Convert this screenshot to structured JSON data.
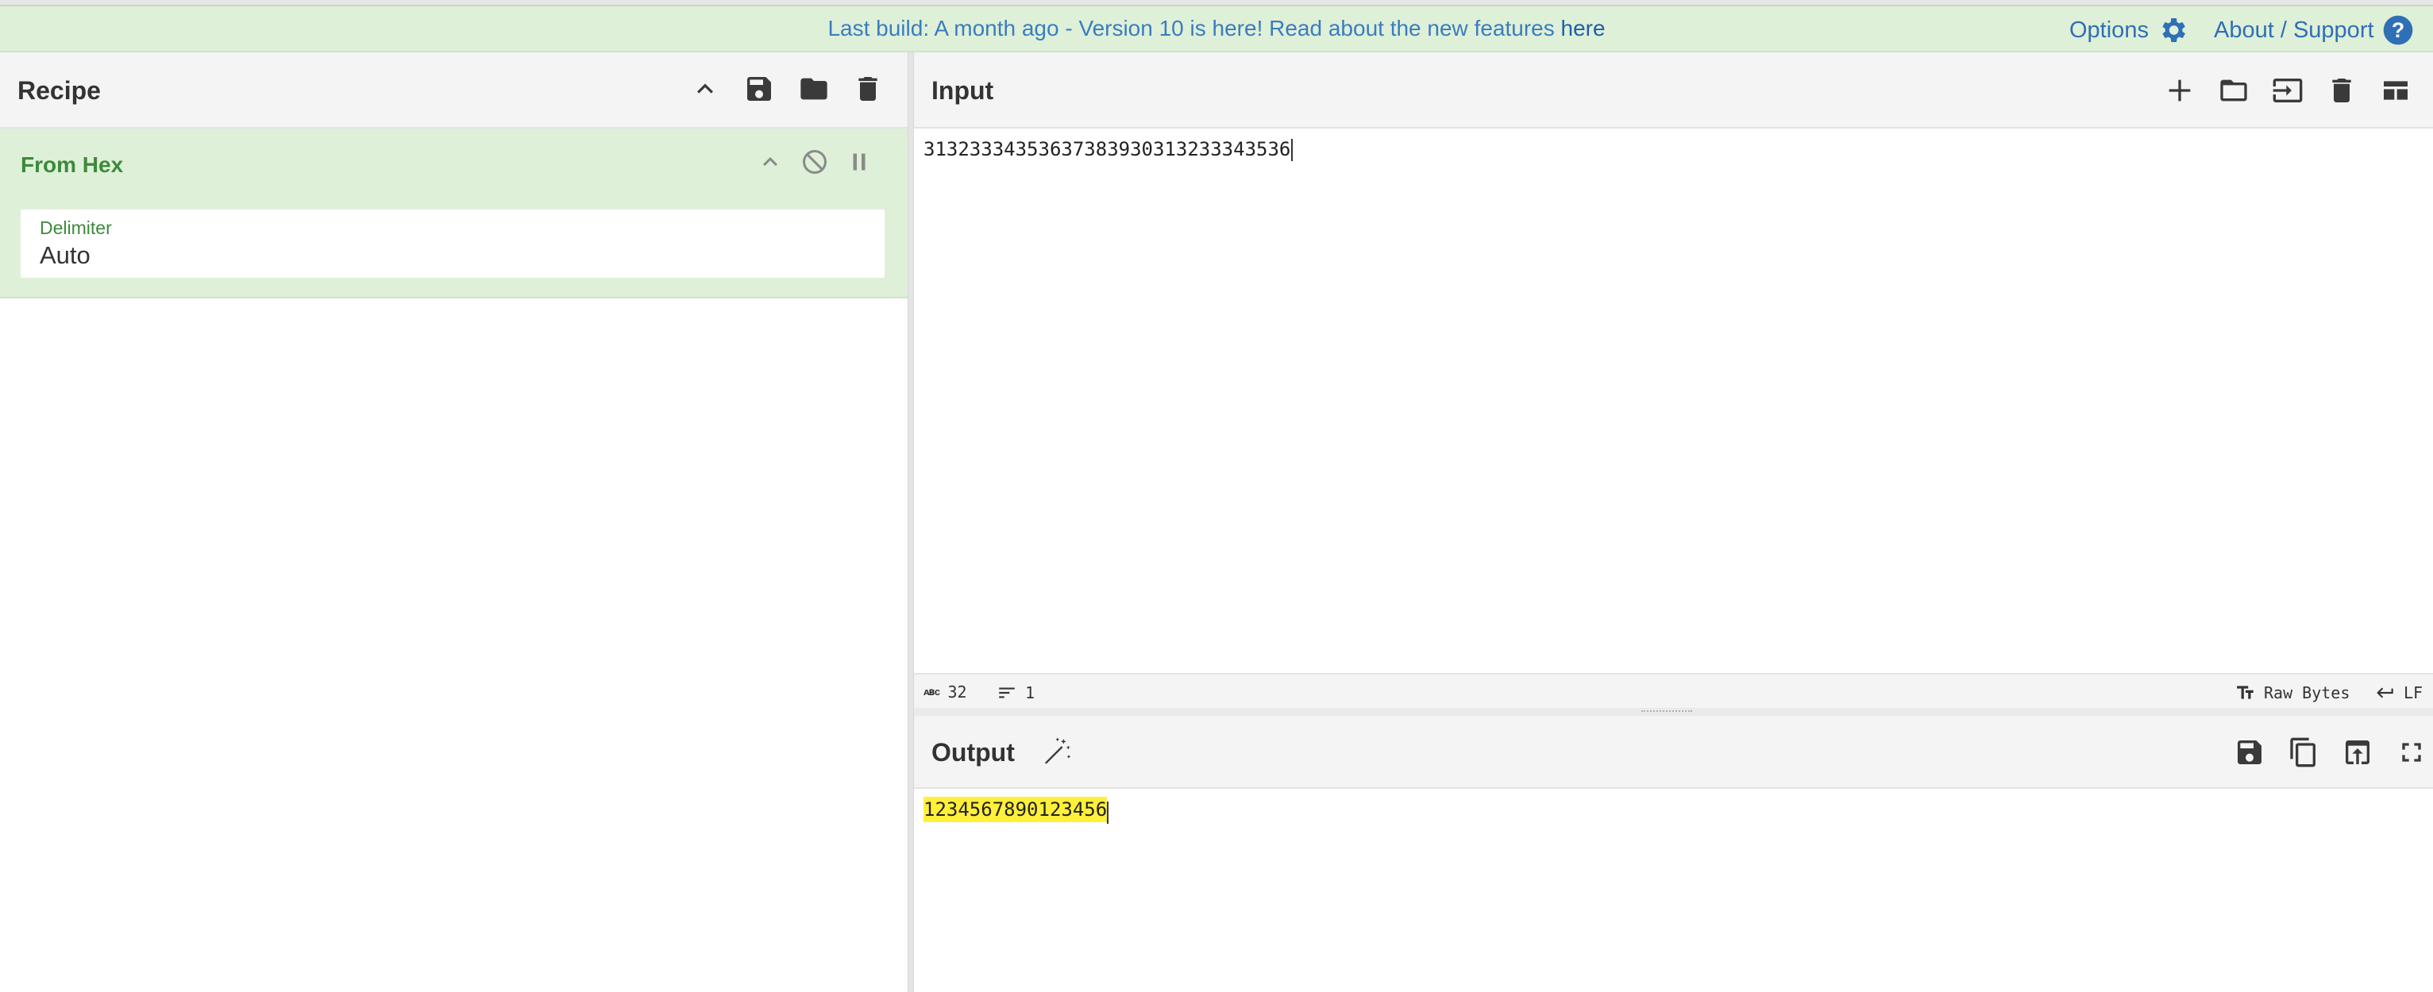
{
  "banner": {
    "message": "Last build: A month ago - Version 10 is here! Read about the new features ",
    "link_text": "here",
    "options_label": "Options",
    "about_label": "About / Support"
  },
  "recipe": {
    "title": "Recipe",
    "operation": {
      "name": "From Hex",
      "arg_label": "Delimiter",
      "arg_value": "Auto"
    }
  },
  "input": {
    "title": "Input",
    "text": "31323334353637383930313233343536",
    "status": {
      "length": "32",
      "lines": "1",
      "encoding": "Raw Bytes",
      "eol": "LF"
    }
  },
  "output": {
    "title": "Output",
    "text": "1234567890123456"
  },
  "colors": {
    "banner_bg": "#dff0d8",
    "op_green": "#3c8a3c",
    "link_blue": "#2f6fb5",
    "highlight": "#fff03a"
  }
}
